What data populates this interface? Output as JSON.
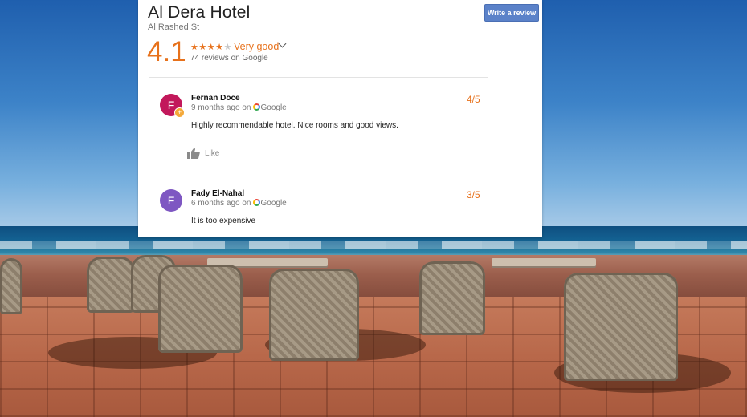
{
  "hotel": {
    "name": "Al Dera Hotel",
    "address": "Al Rashed St",
    "write_review_label": "Write a review",
    "rating": "4.1",
    "stars_filled": 4,
    "stars_total": 5,
    "rating_word": "Very good",
    "reviews_summary": "74 reviews on Google"
  },
  "reviews": [
    {
      "initial": "F",
      "author": "Fernan Doce",
      "time": "9 months ago on",
      "source": "Google",
      "score": "4/5",
      "text": "Highly recommendable hotel. Nice rooms and good views.",
      "like_label": "Like",
      "avatar_color": "#c2185b"
    },
    {
      "initial": "F",
      "author": "Fady El-Nahal",
      "time": "6 months ago on",
      "source": "Google",
      "score": "3/5",
      "text": "It is too expensive",
      "avatar_color": "#7e57c2"
    }
  ],
  "colors": {
    "accent": "#e7711b",
    "button": "#5b82c9"
  }
}
